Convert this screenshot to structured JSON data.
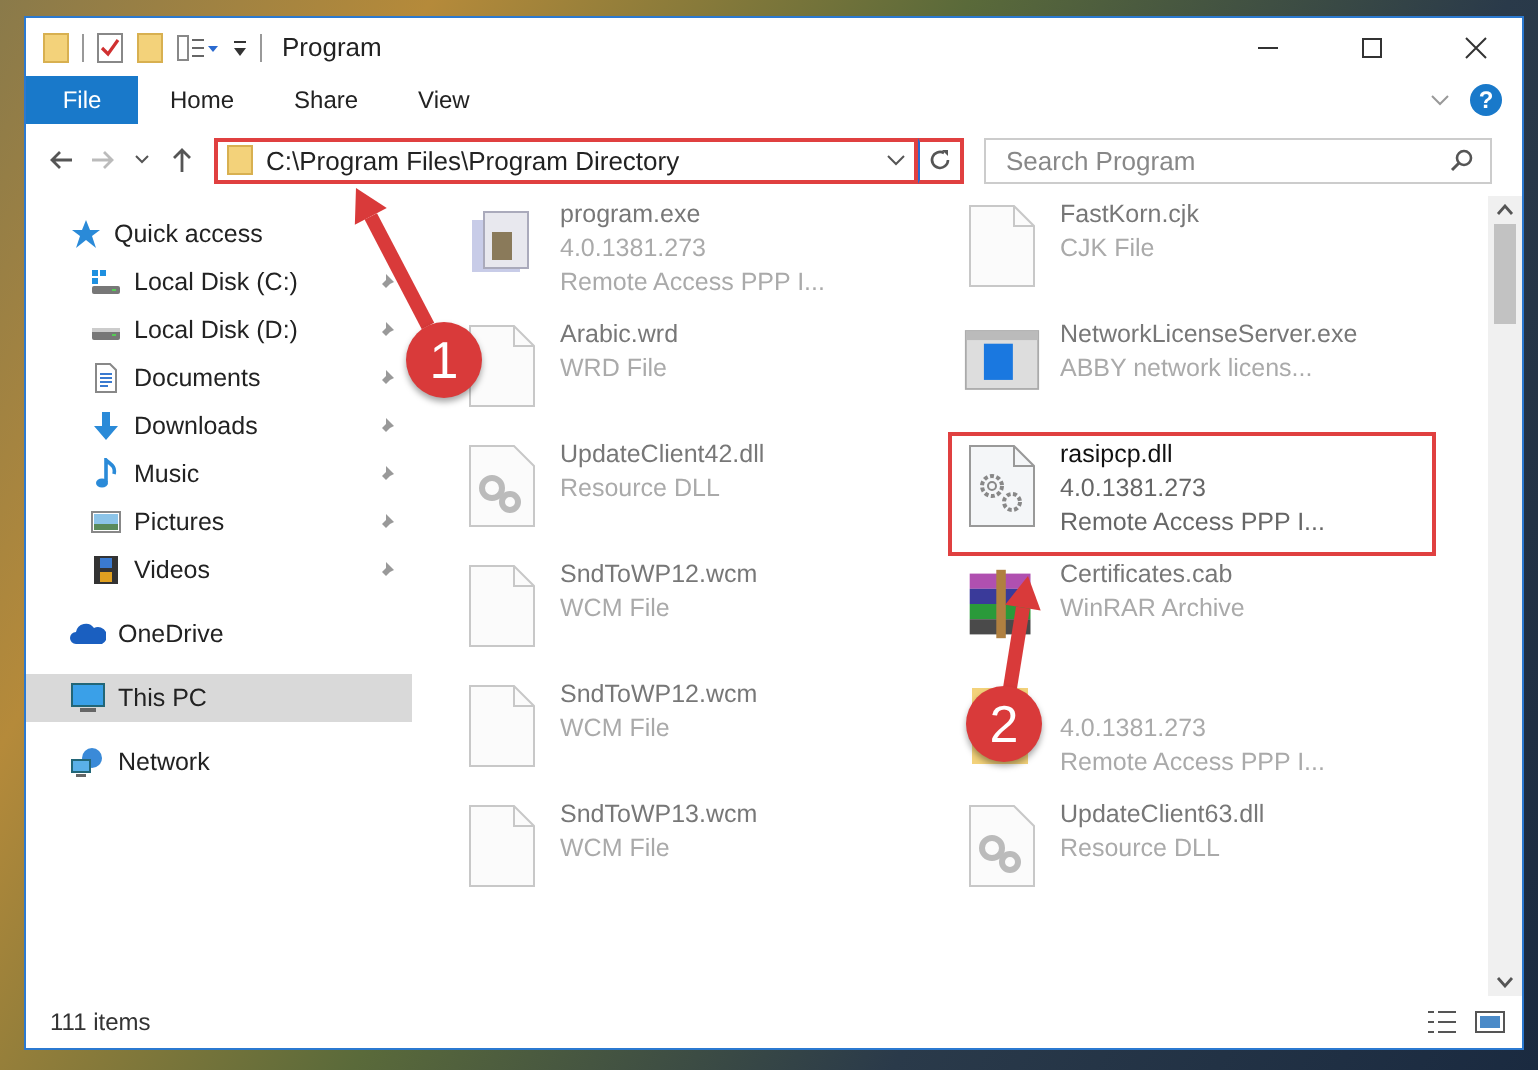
{
  "window": {
    "title": "Program"
  },
  "ribbon": {
    "tabs": [
      {
        "label": "File",
        "kind": "file_menu"
      },
      {
        "label": "Home",
        "kind": "tab"
      },
      {
        "label": "Share",
        "kind": "tab"
      },
      {
        "label": "View",
        "kind": "tab"
      }
    ],
    "help": "?"
  },
  "address_bar": {
    "path": "C:\\Program Files\\Program Directory",
    "highlighted": true
  },
  "search": {
    "placeholder": "Search Program"
  },
  "sidebar": {
    "items": [
      {
        "label": "Quick access",
        "kind": "star",
        "selected": false,
        "children": [
          {
            "label": "Local Disk (C:)",
            "kind": "drive_system",
            "pinned": true,
            "selected": false
          },
          {
            "label": "Local Disk (D:)",
            "kind": "drive",
            "pinned": true,
            "selected": false
          },
          {
            "label": "Documents",
            "kind": "documents",
            "pinned": true,
            "selected": false
          },
          {
            "label": "Downloads",
            "kind": "downloads",
            "pinned": true,
            "selected": false
          },
          {
            "label": "Music",
            "kind": "music",
            "pinned": true,
            "selected": false
          },
          {
            "label": "Pictures",
            "kind": "pictures",
            "pinned": true,
            "selected": false
          },
          {
            "label": "Videos",
            "kind": "videos",
            "pinned": true,
            "selected": false
          }
        ]
      },
      {
        "label": "OneDrive",
        "kind": "cloud",
        "selected": false
      },
      {
        "label": "This PC",
        "kind": "pc",
        "selected": true
      },
      {
        "label": "Network",
        "kind": "network",
        "selected": false
      }
    ]
  },
  "files": [
    {
      "kind": "app",
      "name": "program.exe",
      "lines": [
        "4.0.1381.273",
        "Remote Access PPP I..."
      ],
      "highlighted": false
    },
    {
      "kind": "blank",
      "name": "FastKorn.cjk",
      "lines": [
        "CJK File"
      ],
      "highlighted": false
    },
    {
      "kind": "blank",
      "name": "Arabic.wrd",
      "lines": [
        "WRD File"
      ],
      "highlighted": false
    },
    {
      "kind": "window",
      "name": "NetworkLicenseServer.exe",
      "lines": [
        "ABBY network licens..."
      ],
      "highlighted": false
    },
    {
      "kind": "dll",
      "name": "UpdateClient42.dll",
      "lines": [
        "Resource DLL"
      ],
      "highlighted": false
    },
    {
      "kind": "gears",
      "name": "rasipcp.dll",
      "lines": [
        "4.0.1381.273",
        "Remote Access PPP I..."
      ],
      "highlighted": true
    },
    {
      "kind": "blank",
      "name": "SndToWP12.wcm",
      "lines": [
        "WCM File"
      ],
      "highlighted": false
    },
    {
      "kind": "archive",
      "name": "Certificates.cab",
      "lines": [
        "WinRAR Archive"
      ],
      "highlighted": false
    },
    {
      "kind": "blank",
      "name": "SndToWP12.wcm",
      "lines": [
        "WCM File"
      ],
      "highlighted": false
    },
    {
      "kind": "zip",
      "lines": [
        "4.0.1381.273",
        "Remote Access PPP I..."
      ],
      "highlighted": false
    },
    {
      "kind": "blank",
      "name": "SndToWP13.wcm",
      "lines": [
        "WCM File"
      ],
      "highlighted": false
    },
    {
      "kind": "dll",
      "name": "UpdateClient63.dll",
      "lines": [
        "Resource DLL"
      ],
      "highlighted": false
    }
  ],
  "status_bar": {
    "item_count": "111 items"
  },
  "annotations": [
    {
      "label": "1"
    },
    {
      "label": "2"
    }
  ]
}
